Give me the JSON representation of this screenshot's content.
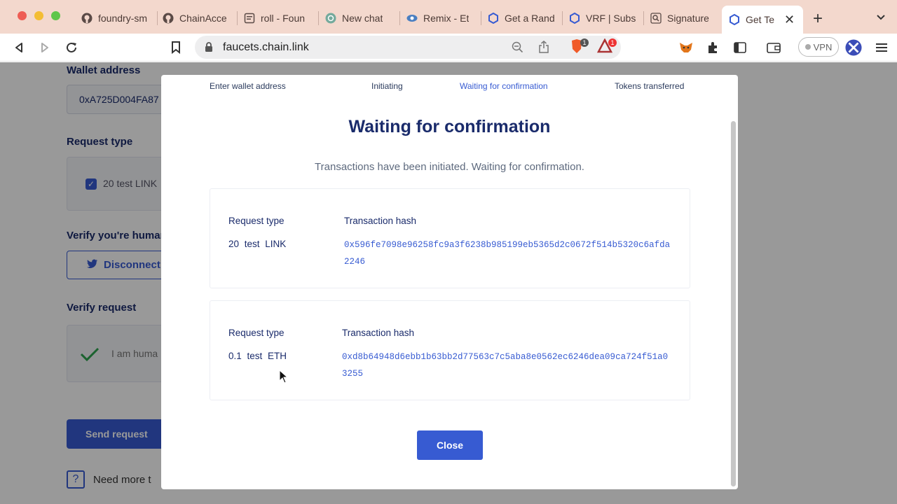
{
  "browser": {
    "tabs": [
      {
        "label": "foundry-sm",
        "icon": "github-icon"
      },
      {
        "label": "ChainAcce",
        "icon": "github-icon"
      },
      {
        "label": "roll - Foun",
        "icon": "document-icon"
      },
      {
        "label": "New chat",
        "icon": "chatgpt-icon"
      },
      {
        "label": "Remix - Et",
        "icon": "remix-icon"
      },
      {
        "label": "Get a Rand",
        "icon": "chainlink-icon"
      },
      {
        "label": "VRF | Subs",
        "icon": "chainlink-icon"
      },
      {
        "label": "Signature",
        "icon": "search-icon"
      },
      {
        "label": "Get Te",
        "icon": "chainlink-icon",
        "active": true
      }
    ],
    "url": "faucets.chain.link",
    "brave_shield_count": "1",
    "rewards_count": "1",
    "vpn_label": "VPN"
  },
  "page": {
    "wallet_label": "Wallet address",
    "wallet_value": "0xA725D004FA87",
    "request_type_label": "Request type",
    "request_option": "20 test LINK",
    "verify_human_label": "Verify you're human",
    "disconnect_label": "Disconnect",
    "verify_request_label": "Verify request",
    "human_text": "I am huma",
    "send_label": "Send request",
    "help_text": "Need more t"
  },
  "modal": {
    "steps": [
      "Enter wallet address",
      "Initiating",
      "Waiting for confirmation",
      "Tokens transferred"
    ],
    "active_step": 2,
    "title": "Waiting for confirmation",
    "subtitle": "Transactions have been initiated. Waiting for confirmation.",
    "transactions": [
      {
        "request_type_label": "Request type",
        "request_type": "20 test LINK",
        "hash_label": "Transaction hash",
        "hash": "0x596fe7098e96258fc9a3f6238b985199eb5365d2c0672f514b5320c6afda2246"
      },
      {
        "request_type_label": "Request type",
        "request_type": "0.1 test ETH",
        "hash_label": "Transaction hash",
        "hash": "0xd8b64948d6ebb1b63bb2d77563c7c5aba8e0562ec6246dea09ca724f51a03255"
      }
    ],
    "close_label": "Close"
  },
  "colors": {
    "accent": "#375bd2",
    "heading": "#1a2b6b",
    "tabbar": "#f3d8cd"
  }
}
